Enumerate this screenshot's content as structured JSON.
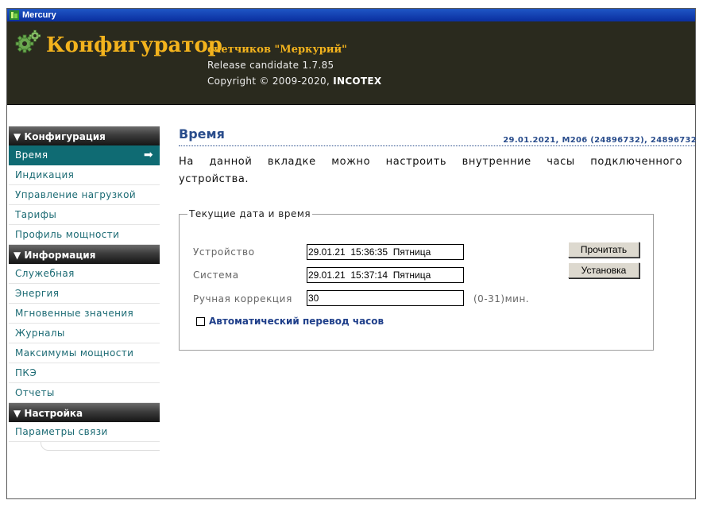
{
  "window": {
    "title": "Mercury"
  },
  "header": {
    "brand": "Конфигуратор",
    "subtitle": "счетчиков \"Меркурий\"",
    "release": "Release candidate 1.7.85",
    "copyright": "Copyright © 2009-2020,",
    "company": "INCOTEX"
  },
  "sidebar": {
    "sections": [
      {
        "title": "▼ Конфигурация",
        "items": [
          "Время",
          "Индикация",
          "Управление нагрузкой",
          "Тарифы",
          "Профиль мощности"
        ]
      },
      {
        "title": "▼ Информация",
        "items": [
          "Служебная",
          "Энергия",
          "Мгновенные значения",
          "Журналы",
          "Максимумы мощности",
          "ПКЭ",
          "Отчеты"
        ]
      },
      {
        "title": "▼ Настройка",
        "items": [
          "Параметры связи"
        ]
      }
    ],
    "active_item": "Время",
    "active_icon": "arrow-right-icon"
  },
  "main": {
    "title": "Время",
    "device_info": "29.01.2021, M206 (24896732), 24896732",
    "description": "На данной вкладке можно настроить внутренние часы подключенного устройства.",
    "group": {
      "legend": "Текущие дата и время",
      "device_label": "Устройство",
      "device_value": "29.01.21  15:36:35  Пятница",
      "system_label": "Система",
      "system_value": "29.01.21  15:37:14  Пятница",
      "manual_label": "Ручная коррекция",
      "manual_value": "30",
      "manual_unit": "(0-31)мин.",
      "auto_dst_label": "Автоматический перевод часов",
      "auto_dst_checked": false,
      "read_button": "Прочитать",
      "set_button": "Установка"
    }
  },
  "colors": {
    "header_bg": "#2a2a1e",
    "brand": "#f3b31d",
    "active_nav": "#0f6b73",
    "nav_text": "#1c6b74",
    "title_blue": "#2a4d8c"
  }
}
